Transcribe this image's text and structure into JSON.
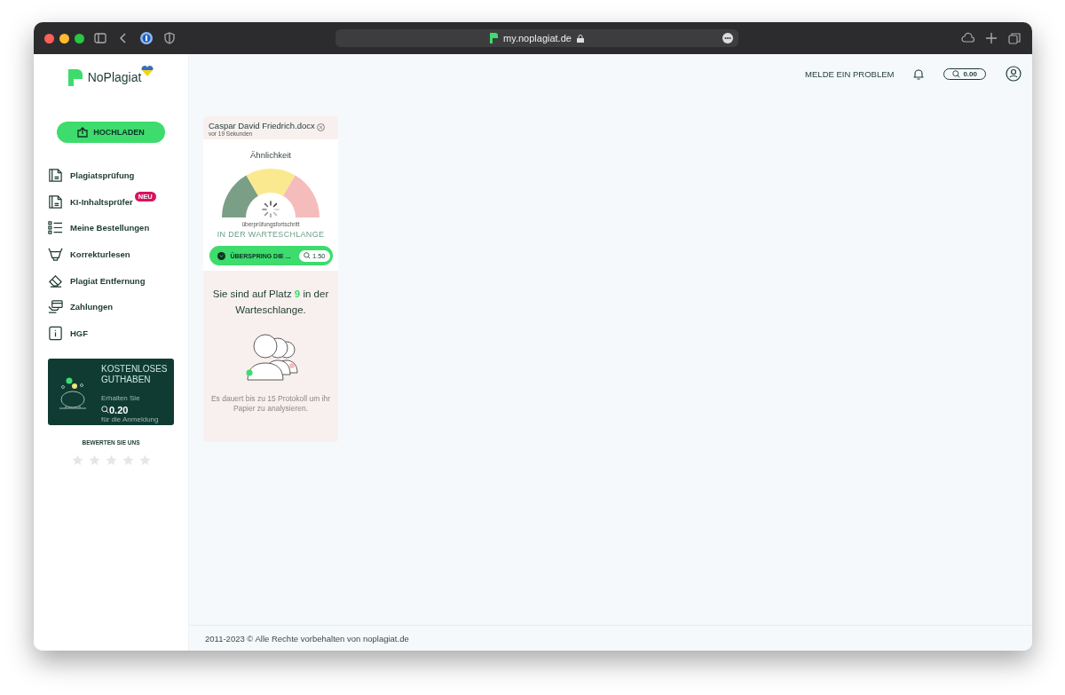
{
  "browser": {
    "url": "my.noplagiat.de"
  },
  "logo": {
    "name": "NoPlagiat"
  },
  "upload_button": "HOCHLADEN",
  "nav": [
    {
      "label": "Plagiatsprüfung",
      "kind": "document"
    },
    {
      "label": "KI-Inhaltsprüfer",
      "kind": "document",
      "badge": "NEU"
    },
    {
      "label": "Meine Bestellungen",
      "kind": "list"
    },
    {
      "label": "Korrekturlesen",
      "kind": "cup"
    },
    {
      "label": "Plagiat Entfernung",
      "kind": "eraser"
    },
    {
      "label": "Zahlungen",
      "kind": "payment"
    },
    {
      "label": "HGF",
      "kind": "info"
    }
  ],
  "promo": {
    "title": "KOSTENLOSES GUTHABEN",
    "text_before": "Erhalten Sie",
    "amount": "0.20",
    "text_after": "für die Anmeldung"
  },
  "rating": {
    "label": "BEWERTEN SIE UNS",
    "stars": 0
  },
  "header": {
    "report_link": "MELDE EIN PROBLEM",
    "balance": "0.00"
  },
  "document": {
    "filename": "Caspar David Friedrich.docx",
    "time": "vor 19 Sekunden",
    "similarity_label": "Ähnlichkeit",
    "progress_label": "überprüfungsfortschritt",
    "status": "IN DER WARTESCHLANGE",
    "skip_button": "ÜBERSPRING DIE ...",
    "skip_price": "1.50",
    "queue_text": "Sie sind auf Platz **9** in der Warteschlange.",
    "eta_text": "Es dauert bis zu 15 Protokoll um ihr Papier zu analysieren."
  },
  "footer": "2011-2023 © Alle Rechte vorbehalten von noplagiat.de"
}
